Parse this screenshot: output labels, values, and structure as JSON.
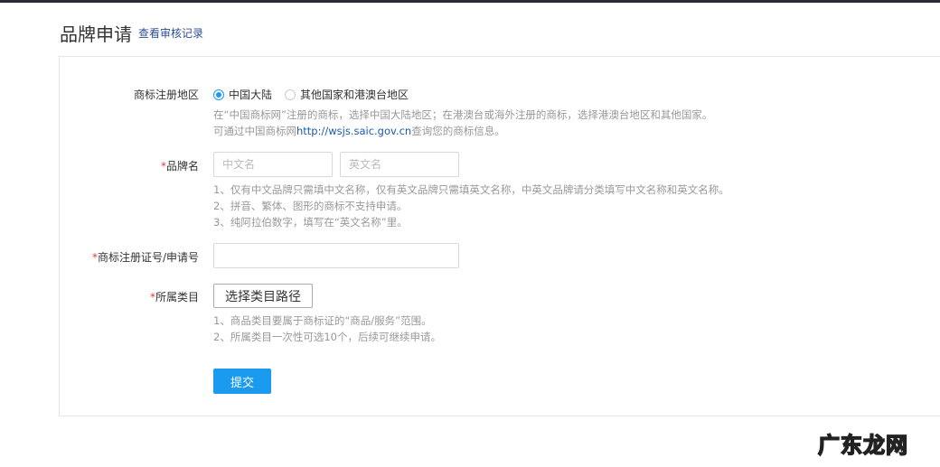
{
  "header": {
    "title": "品牌申请",
    "review_link": "查看审核记录"
  },
  "form": {
    "region": {
      "label": "商标注册地区",
      "options": [
        "中国大陆",
        "其他国家和港澳台地区"
      ],
      "selected": 0,
      "help1": "在“中国商标网”注册的商标，选择中国大陆地区；在港澳台或海外注册的商标，选择港澳台地区和其他国家。",
      "help2_pre": "可通过中国商标网",
      "help2_link": "http://wsjs.saic.gov.cn",
      "help2_post": "查询您的商标信息。"
    },
    "brand": {
      "required": "*",
      "label": "品牌名",
      "cn_placeholder": "中文名",
      "en_placeholder": "英文名",
      "help": [
        "1、仅有中文品牌只需填中文名称，仅有英文品牌只需填英文名称，中英文品牌请分类填写中文名称和英文名称。",
        "2、拼音、繁体、图形的商标不支持申请。",
        "3、纯阿拉伯数字，填写在“英文名称”里。"
      ]
    },
    "reg_no": {
      "required": "*",
      "label": "商标注册证号/申请号",
      "value": ""
    },
    "category": {
      "required": "*",
      "label": "所属类目",
      "button": "选择类目路径",
      "help": [
        "1、商品类目要属于商标证的“商品/服务”范围。",
        "2、所属类目一次性可选10个，后续可继续申请。"
      ]
    },
    "submit": "提交"
  },
  "watermark": "广东龙网"
}
